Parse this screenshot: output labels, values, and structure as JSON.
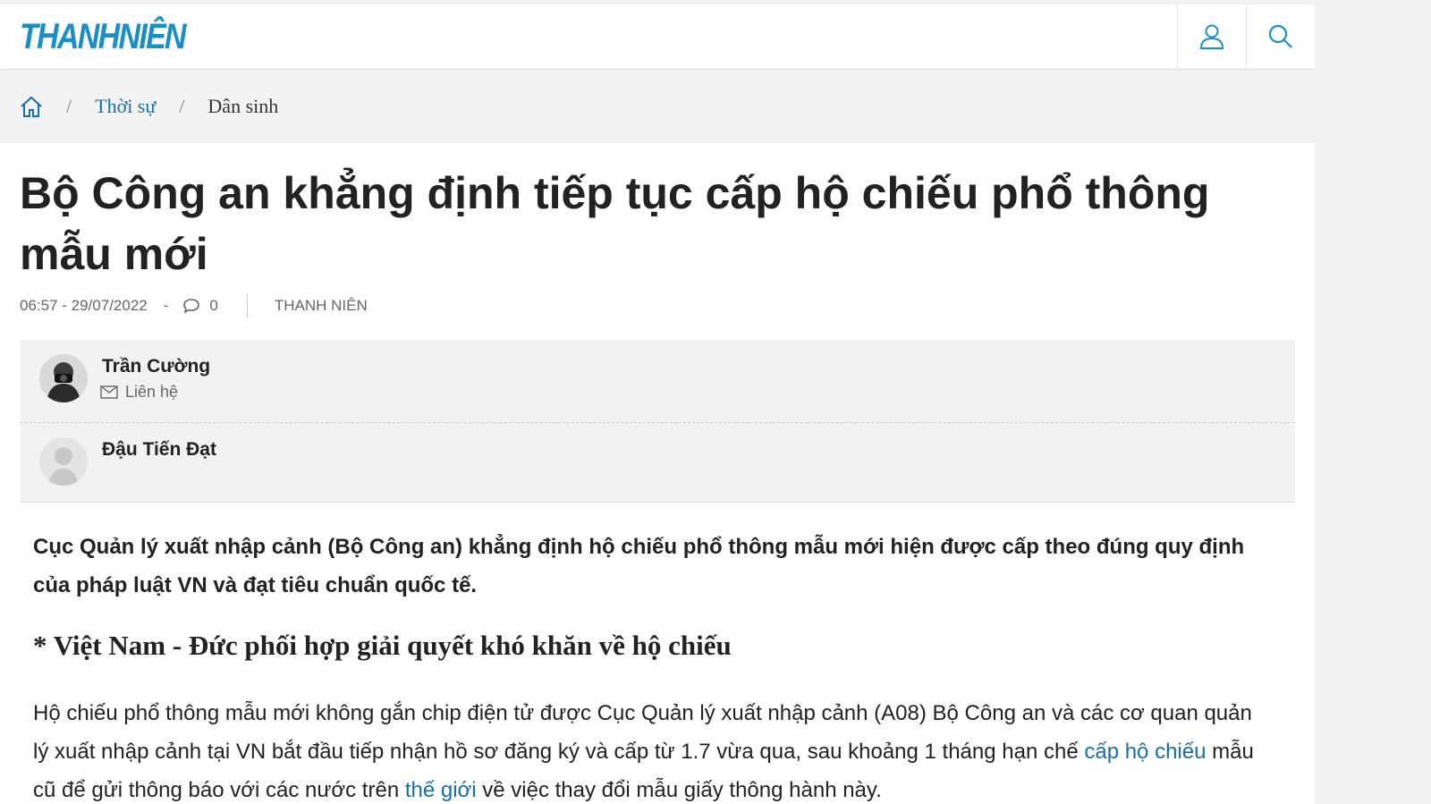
{
  "header": {
    "logo_text": "THANHNIÊN",
    "brand_color": "#1a8fc7",
    "actions": [
      {
        "name": "user-icon"
      },
      {
        "name": "search-icon"
      }
    ]
  },
  "breadcrumb": {
    "home_icon": "home-icon",
    "separator": "/",
    "items": [
      "Thời sự",
      "Dân sinh"
    ]
  },
  "article": {
    "title": "Bộ Công an khẳng định tiếp tục cấp hộ chiếu phổ thông mẫu mới",
    "datetime": "06:57 - 29/07/2022",
    "dash": "-",
    "comment_count": "0",
    "source": "THANH NIÊN",
    "authors": [
      {
        "name": "Trần Cường",
        "contact_label": "Liên hệ"
      },
      {
        "name": "Đậu Tiến Đạt"
      }
    ],
    "sapo": "Cục Quản lý xuất nhập cảnh (Bộ Công an) khẳng định hộ chiếu phổ thông mẫu mới hiện được cấp theo đúng quy định của pháp luật VN và đạt tiêu chuẩn quốc tế.",
    "related": "* Việt Nam - Đức phối hợp giải quyết khó khăn về hộ chiếu",
    "body_part1": "Hộ chiếu phổ thông mẫu mới không gắn chip điện tử được Cục Quản lý xuất nhập cảnh (A08) Bộ Công an và các cơ quan quản lý xuất nhập cảnh tại VN bắt đầu tiếp nhận hồ sơ đăng ký và cấp từ 1.7 vừa qua, sau khoảng 1 tháng hạn chế ",
    "body_link1": "cấp hộ chiếu",
    "body_part2": " mẫu cũ để gửi thông báo với các nước trên ",
    "body_link2": "thế giới",
    "body_part3": " về việc thay đổi mẫu giấy thông hành này."
  }
}
